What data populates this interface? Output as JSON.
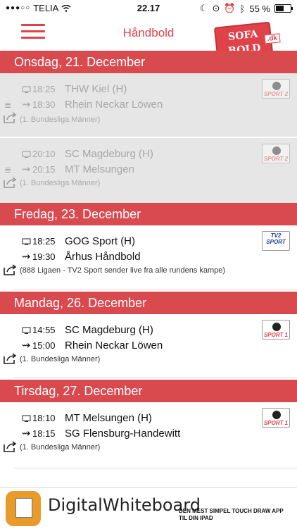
{
  "status_bar": {
    "carrier": "TELIA",
    "time": "22.17",
    "battery": "55 %",
    "battery_level": 0.55
  },
  "header": {
    "title": "Håndbold",
    "logo_line1": "SOFA",
    "logo_line2": "BOLD",
    "logo_suffix": ".dk"
  },
  "colors": {
    "accent": "#e0424a",
    "day_header": "#d94a4f",
    "dimmed_row": "#e6e6e6"
  },
  "days": [
    {
      "label": "Onsdag, 21. December",
      "matches": [
        {
          "tv_time": "18:25",
          "home": "THW Kiel (H)",
          "start_time": "18:30",
          "away": "Rhein Neckar Löwen",
          "league": "(1. Bundesliga Männer)",
          "channel": "SPORT 2",
          "dimmed": true
        },
        {
          "tv_time": "20:10",
          "home": "SC Magdeburg (H)",
          "start_time": "20:15",
          "away": "MT Melsungen",
          "league": "(1. Bundesliga Männer)",
          "channel": "SPORT 2",
          "dimmed": true
        }
      ]
    },
    {
      "label": "Fredag, 23. December",
      "matches": [
        {
          "tv_time": "18:25",
          "home": "GOG Sport (H)",
          "start_time": "19:30",
          "away": "Århus Håndbold",
          "league": "(888 Ligaen - TV2 Sport sender live fra alle rundens kampe)",
          "channel": "TV2 SPORT",
          "dimmed": false
        }
      ]
    },
    {
      "label": "Mandag, 26. December",
      "matches": [
        {
          "tv_time": "14:55",
          "home": "SC Magdeburg (H)",
          "start_time": "15:00",
          "away": "Rhein Neckar Löwen",
          "league": "(1. Bundesliga Männer)",
          "channel": "SPORT 1",
          "dimmed": false
        }
      ]
    },
    {
      "label": "Tirsdag, 27. December",
      "matches": [
        {
          "tv_time": "18:10",
          "home": "MT Melsungen (H)",
          "start_time": "18:15",
          "away": "SG Flensburg-Handewitt",
          "league": "(1. Bundesliga Männer)",
          "channel": "SPORT 1",
          "dimmed": false
        }
      ]
    }
  ],
  "ad": {
    "app_name": "DigitalWhiteboard",
    "tagline": "DEN MEST SIMPEL TOUCH DRAW APP TIL DIN IPAD"
  }
}
